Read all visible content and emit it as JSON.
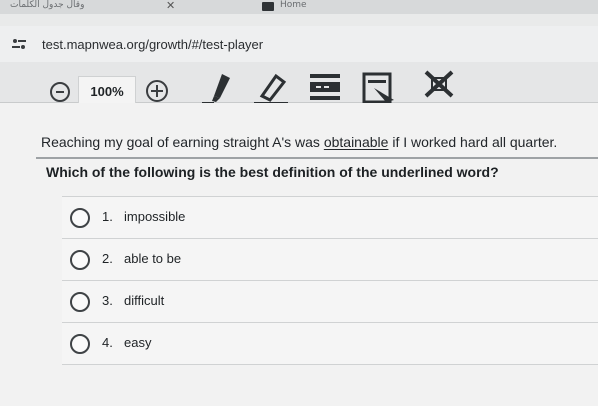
{
  "browser": {
    "tab1_title": "وقال جدول الكلمات",
    "tab2_title": "Home",
    "url": "test.mapnwea.org/growth/#/test-player"
  },
  "toolbar": {
    "zoom_level": "100%",
    "tools": [
      "highlighter-icon",
      "eraser-icon",
      "line-reader-icon",
      "answer-masking-icon",
      "answer-eliminator-icon"
    ]
  },
  "passage": {
    "before": "Reaching my goal of earning straight A's was ",
    "underlined": "obtainable",
    "after": " if I worked hard all quarter."
  },
  "question": "Which of the following is the best definition of the underlined word?",
  "options": [
    {
      "num": "1.",
      "text": "impossible"
    },
    {
      "num": "2.",
      "text": "able to be"
    },
    {
      "num": "3.",
      "text": "difficult"
    },
    {
      "num": "4.",
      "text": "easy"
    }
  ]
}
